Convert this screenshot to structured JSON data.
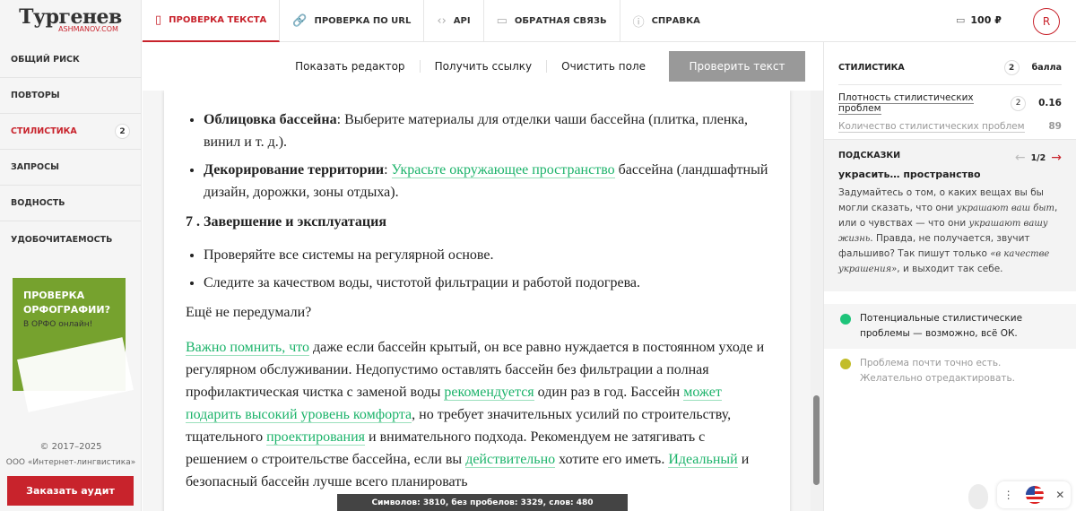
{
  "logo": {
    "title": "Тургенев",
    "subtitle": "ASHMANOV.COM"
  },
  "tabs": [
    {
      "label": "ПРОВЕРКА ТЕКСТА",
      "icon": "▯"
    },
    {
      "label": "ПРОВЕРКА ПО URL",
      "icon": "🔗"
    },
    {
      "label": "API",
      "icon": "‹›"
    },
    {
      "label": "ОБРАТНАЯ СВЯЗЬ",
      "icon": "▭"
    },
    {
      "label": "СПРАВКА",
      "icon": "ⓘ"
    }
  ],
  "balance": "100 ₽",
  "avatar": "R",
  "sidebar": {
    "items": [
      {
        "label": "ОБЩИЙ РИСК"
      },
      {
        "label": "ПОВТОРЫ"
      },
      {
        "label": "СТИЛИСТИКА",
        "badge": "2"
      },
      {
        "label": "ЗАПРОСЫ"
      },
      {
        "label": "ВОДНОСТЬ"
      },
      {
        "label": "УДОБОЧИТАЕМОСТЬ"
      }
    ],
    "ad": {
      "line1": "ПРОВЕРКА",
      "line2": "ОРФОГРАФИИ?",
      "line3": "В ОРФО онлайн!"
    },
    "copyright": "© 2017–2025",
    "company": "ООО «Интернет-лингвистика»",
    "audit": "Заказать аудит"
  },
  "toolbar": {
    "show_editor": "Показать редактор",
    "get_link": "Получить ссылку",
    "clear": "Очистить поле",
    "check": "Проверить текст"
  },
  "document": {
    "bullets1": [
      [
        {
          "b": "Облицовка бассейна"
        },
        {
          "t": ": Выберите материалы для отделки чаши бассейна (плитка, пленка, винил и т. д.)."
        }
      ],
      [
        {
          "b": "Декорирование территории"
        },
        {
          "t": ": "
        },
        {
          "h": "Украсьте окружающее пространство"
        },
        {
          "t": " бассейна (ландшафтный дизайн, дорожки, зоны отдыха)."
        }
      ]
    ],
    "heading": "7 . Завершение и эксплуатация",
    "bullets2": [
      [
        {
          "t": "Проверяйте все системы на регулярной основе."
        }
      ],
      [
        {
          "t": "Следите за качеством воды, чистотой фильтрации и работой подогрева."
        }
      ]
    ],
    "para1": [
      {
        "t": "Ещё не передумали?"
      }
    ],
    "para2": [
      {
        "h": "Важно помнить, что"
      },
      {
        "t": " даже если бассейн крытый, он все равно нуждается в постоянном уходе и регулярном обслуживании. Недопустимо оставлять бассейн без фильтрации а полная профилактическая чистка с заменой воды "
      },
      {
        "h": "рекомендуется"
      },
      {
        "t": " один раз в год. Бассейн "
      },
      {
        "h": "может подарить высокий уровень комфорта"
      },
      {
        "t": ", но требует значительных усилий по строительству, тщательного "
      },
      {
        "h": "проектирования"
      },
      {
        "t": " и внимательного подхода. Рекомендуем не затягивать с решением о строительстве бассейна, если вы "
      },
      {
        "h": "действительно"
      },
      {
        "t": " хотите его иметь. "
      },
      {
        "h": "Идеальный"
      },
      {
        "t": " и безопасный бассейн лучше всего планировать"
      }
    ]
  },
  "counter": "Символов: 3810, без пробелов: 3329, слов: 480",
  "right": {
    "title": "СТИЛИСТИКА",
    "score": "2",
    "score_unit": "балла",
    "metrics": [
      {
        "label": "Плотность стилистических проблем",
        "badge": "2",
        "value": "0.16"
      },
      {
        "label": "Количество стилистических проблем",
        "value": "89"
      }
    ],
    "hints": {
      "title": "ПОДСКАЗКИ",
      "page": "1/2",
      "phrase": "украсить… пространство",
      "text": [
        {
          "t": "Задумайтесь о том, о каких вещах вы бы могли сказать, что они "
        },
        {
          "i": "украшают ваш быт"
        },
        {
          "t": ", или о чувствах — что они "
        },
        {
          "i": "украшают вашу жизнь"
        },
        {
          "t": ". Правда, не получается, звучит фальшиво? Так пишут только "
        },
        {
          "i": "«в качестве украшения»"
        },
        {
          "t": ", и выходит так себе."
        }
      ]
    },
    "legend": [
      {
        "text": "Потенциальные стилистические проблемы — возможно, всё ОК.",
        "color": "#1ec47a"
      },
      {
        "text": "Проблема почти точно есть. Желательно отредактировать.",
        "color": "#c2bd2a"
      }
    ]
  },
  "colors": {
    "accent": "#c8232c",
    "highlight": "#1bb36a"
  }
}
